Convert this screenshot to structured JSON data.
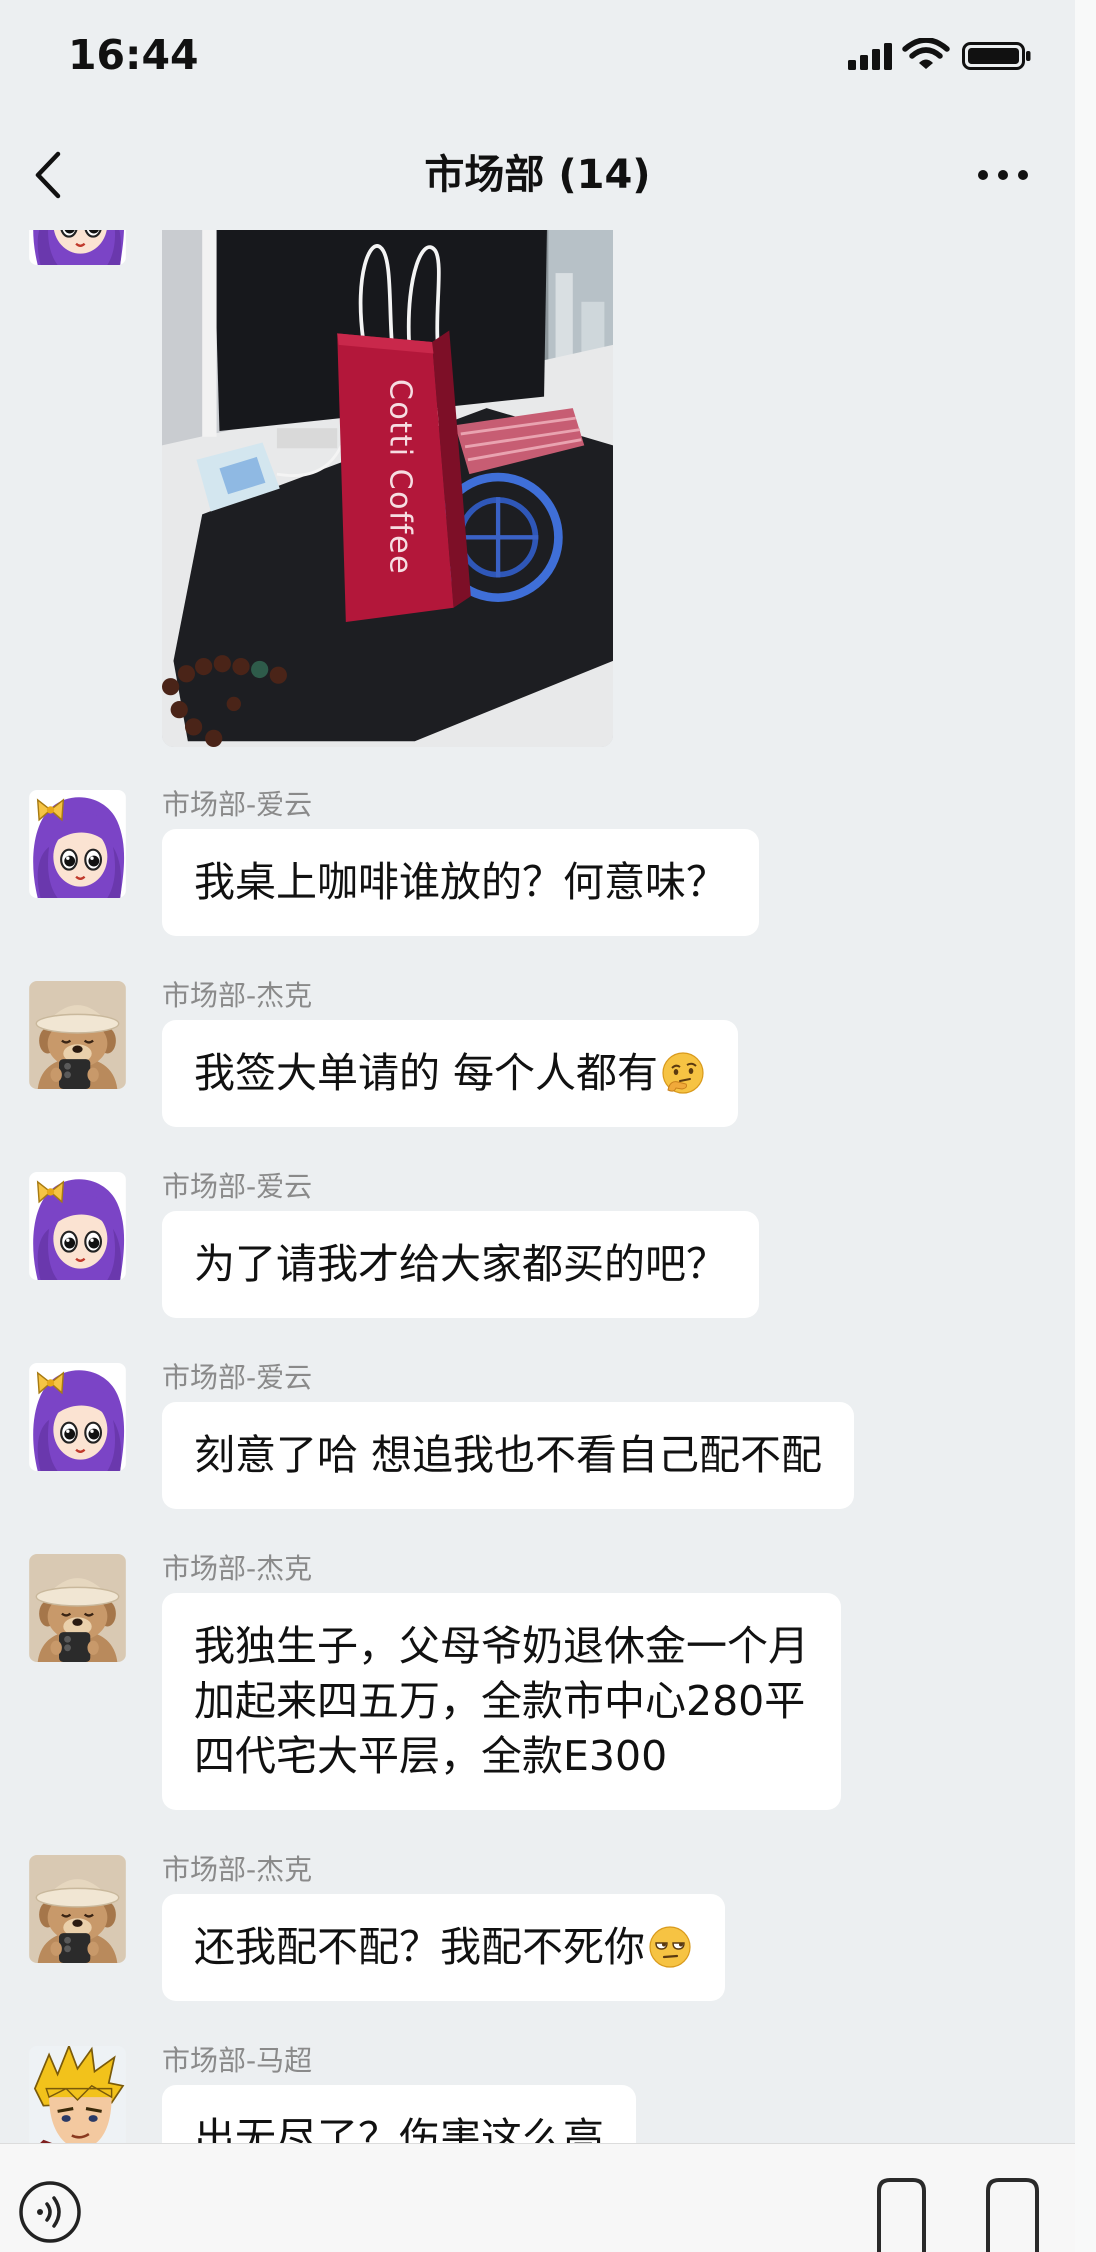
{
  "status_bar": {
    "time": "16:44",
    "icons": [
      "signal-icon",
      "wifi-icon",
      "battery-icon"
    ]
  },
  "header": {
    "title": "市场部 (14)",
    "back_icon": "chevron-left-icon",
    "more_icon": "more-icon"
  },
  "photo_message": {
    "avatar": "purple-hair-girl-avatar",
    "bag_text": "Cotti Coffee"
  },
  "messages": [
    {
      "sender": "市场部-爱云",
      "avatar": "purple-hair-girl-avatar",
      "lines": [
        "我桌上咖啡谁放的？何意味？"
      ]
    },
    {
      "sender": "市场部-杰克",
      "avatar": "dog-with-hat-avatar",
      "lines": [
        "我签大单请的 每个人都有"
      ],
      "emoji": "thinking-face-icon"
    },
    {
      "sender": "市场部-爱云",
      "avatar": "purple-hair-girl-avatar",
      "lines": [
        "为了请我才给大家都买的吧？"
      ]
    },
    {
      "sender": "市场部-爱云",
      "avatar": "purple-hair-girl-avatar",
      "lines": [
        "刻意了哈 想追我也不看自己配不配"
      ]
    },
    {
      "sender": "市场部-杰克",
      "avatar": "dog-with-hat-avatar",
      "lines": [
        "我独生子，父母爷奶退休金一个月",
        "加起来四五万，全款市中心280平",
        "四代宅大平层，全款E300"
      ]
    },
    {
      "sender": "市场部-杰克",
      "avatar": "dog-with-hat-avatar",
      "lines": [
        "还我配不配？我配不死你"
      ],
      "emoji": "unamused-face-icon"
    },
    {
      "sender": "市场部-马超",
      "avatar": "blond-hero-avatar",
      "lines": [
        "出无尽了？伤害这么高"
      ]
    }
  ],
  "input_bar": {
    "voice_icon": "voice-icon",
    "right_icons": [
      "emoji-icon",
      "plus-icon"
    ]
  },
  "colors": {
    "background": "#eceff1",
    "bubble": "#ffffff",
    "sender_text": "#8a8a8a",
    "message_text": "#111111",
    "bag_red": "#b3173a"
  }
}
